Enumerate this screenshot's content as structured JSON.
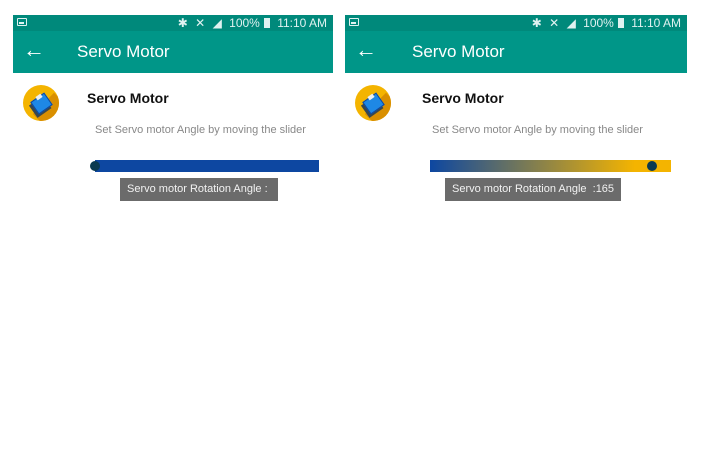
{
  "status_bar": {
    "battery": "100%",
    "time": "11:10 AM"
  },
  "app_bar": {
    "back_icon": "←",
    "title": "Servo Motor"
  },
  "item": {
    "title": "Servo Motor",
    "description": "Set Servo motor Angle by moving the slider"
  },
  "screens": [
    {
      "slider": {
        "value_fraction": 0.0,
        "colors": [
          "#0d47a1"
        ]
      },
      "toast": "Servo motor Rotation Angle : "
    },
    {
      "slider": {
        "value_fraction": 0.92,
        "colors": [
          "#0d47a1",
          "#f4b400"
        ]
      },
      "toast": "Servo motor Rotation Angle  :165"
    }
  ]
}
